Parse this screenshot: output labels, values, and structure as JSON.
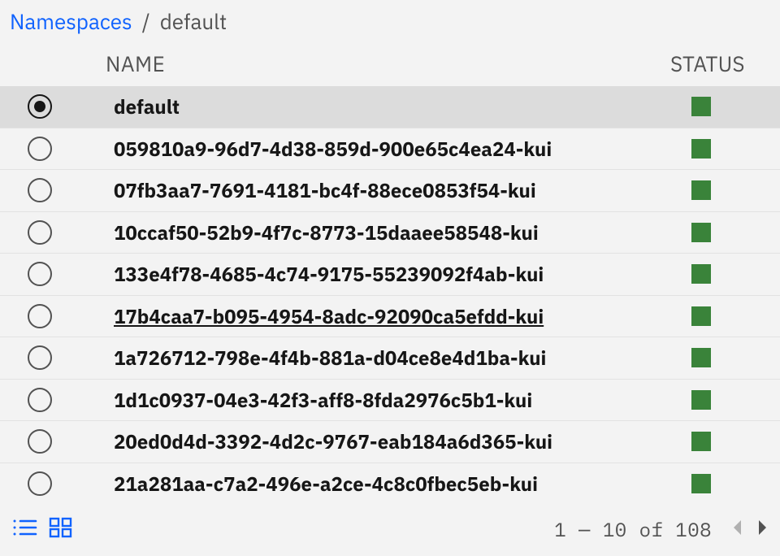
{
  "breadcrumb": {
    "root": "Namespaces",
    "separator": "/",
    "current": "default"
  },
  "table": {
    "headers": {
      "name": "NAME",
      "status": "STATUS"
    },
    "rows": [
      {
        "name": "default",
        "selected": true,
        "status": "active",
        "underlined": false
      },
      {
        "name": "059810a9-96d7-4d38-859d-900e65c4ea24-kui",
        "selected": false,
        "status": "active",
        "underlined": false
      },
      {
        "name": "07fb3aa7-7691-4181-bc4f-88ece0853f54-kui",
        "selected": false,
        "status": "active",
        "underlined": false
      },
      {
        "name": "10ccaf50-52b9-4f7c-8773-15daaee58548-kui",
        "selected": false,
        "status": "active",
        "underlined": false
      },
      {
        "name": "133e4f78-4685-4c74-9175-55239092f4ab-kui",
        "selected": false,
        "status": "active",
        "underlined": false
      },
      {
        "name": "17b4caa7-b095-4954-8adc-92090ca5efdd-kui",
        "selected": false,
        "status": "active",
        "underlined": true
      },
      {
        "name": "1a726712-798e-4f4b-881a-d04ce8e4d1ba-kui",
        "selected": false,
        "status": "active",
        "underlined": false
      },
      {
        "name": "1d1c0937-04e3-42f3-aff8-8fda2976c5b1-kui",
        "selected": false,
        "status": "active",
        "underlined": false
      },
      {
        "name": "20ed0d4d-3392-4d2c-9767-eab184a6d365-kui",
        "selected": false,
        "status": "active",
        "underlined": false
      },
      {
        "name": "21a281aa-c7a2-496e-a2ce-4c8c0fbec5eb-kui",
        "selected": false,
        "status": "active",
        "underlined": false
      }
    ]
  },
  "pagination": {
    "range_start": "1",
    "range_end": "10",
    "total": "108",
    "dash": "—",
    "of_label": "of",
    "prev_disabled": true,
    "next_disabled": false
  },
  "colors": {
    "link": "#0f62fe",
    "status_active": "#3a833a",
    "selected_row": "#dcdcdc"
  }
}
